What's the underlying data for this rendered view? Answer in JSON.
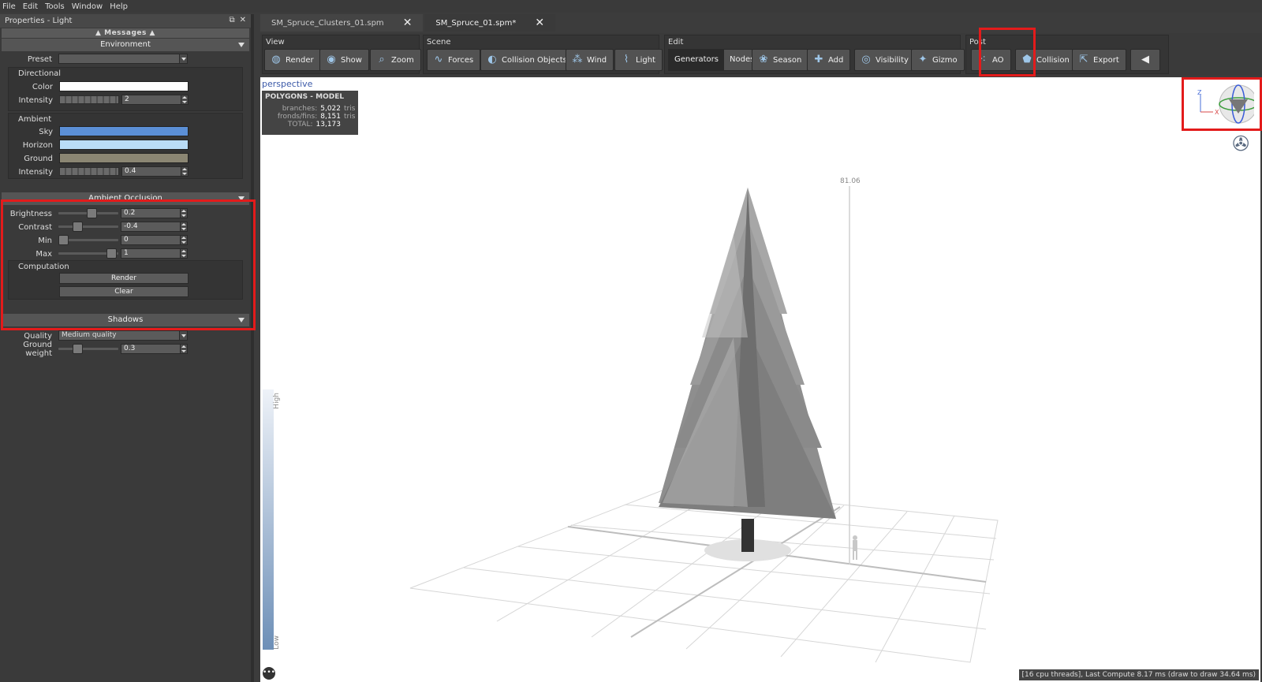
{
  "menu": [
    "File",
    "Edit",
    "Tools",
    "Window",
    "Help"
  ],
  "panel": {
    "title": "Properties - Light",
    "messages": "Messages",
    "environment": {
      "header": "Environment",
      "preset_label": "Preset",
      "preset_value": "",
      "directional_label": "Directional",
      "color_label": "Color",
      "color": "#ffffff",
      "intensity_label": "Intensity",
      "intensity_value": "2",
      "ambient_label": "Ambient",
      "sky_label": "Sky",
      "sky_color": "#5b8fd6",
      "horizon_label": "Horizon",
      "horizon_color": "#b9dcf6",
      "ground_label": "Ground",
      "ground_color": "#8b8673",
      "ambient_intensity_label": "Intensity",
      "ambient_intensity_value": "0.4"
    },
    "ao": {
      "header": "Ambient Occlusion",
      "brightness_label": "Brightness",
      "brightness_value": "0.2",
      "contrast_label": "Contrast",
      "contrast_value": "-0.4",
      "min_label": "Min",
      "min_value": "0",
      "max_label": "Max",
      "max_value": "1",
      "computation_label": "Computation",
      "render_label": "Render",
      "clear_label": "Clear"
    },
    "shadows": {
      "header": "Shadows",
      "quality_label": "Quality",
      "quality_value": "Medium quality",
      "ground_weight_label": "Ground weight",
      "ground_weight_value": "0.3"
    }
  },
  "tabs": [
    {
      "label": "SM_Spruce_Clusters_01.spm",
      "close": "✕"
    },
    {
      "label": "SM_Spruce_01.spm*",
      "close": "✕"
    }
  ],
  "toolbar": {
    "view_label": "View",
    "view_buttons": [
      "Render",
      "Show",
      "Zoom"
    ],
    "scene_label": "Scene",
    "scene_buttons": [
      "Forces",
      "Collision Objects",
      "Wind",
      "Light"
    ],
    "edit_label": "Edit",
    "edit_segment": [
      "Generators",
      "Nodes"
    ],
    "edit_buttons": [
      "Season",
      "Add",
      "Visibility",
      "Gizmo"
    ],
    "post_label": "Post",
    "post_buttons": [
      "AO",
      "Collision",
      "Export"
    ]
  },
  "viewport": {
    "mode": "perspective",
    "stats_title": "POLYGONS - MODEL",
    "stats": [
      {
        "k": "branches:",
        "v": "5,022",
        "u": "tris"
      },
      {
        "k": "fronds/fins:",
        "v": "8,151",
        "u": "tris"
      },
      {
        "k": "TOTAL:",
        "v": "13,173",
        "u": ""
      }
    ],
    "height_value": "81.06",
    "scale_high": "High",
    "scale_low": "Low",
    "status": "[16 cpu threads], Last Compute 8.17 ms (draw to draw 34.64 ms)",
    "more": "•••"
  }
}
